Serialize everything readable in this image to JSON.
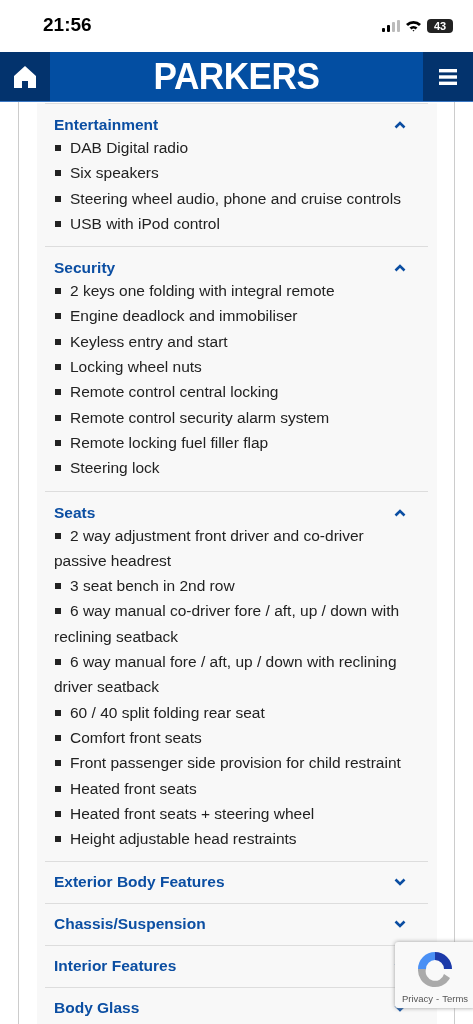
{
  "status_bar": {
    "time": "21:56",
    "battery": "43"
  },
  "header": {
    "logo": "PARKERS"
  },
  "sections": [
    {
      "title": "Entertainment",
      "expanded": true,
      "items": [
        "DAB Digital radio",
        "Six speakers",
        "Steering wheel audio, phone and cruise controls",
        "USB with iPod control"
      ]
    },
    {
      "title": "Security",
      "expanded": true,
      "items": [
        "2 keys one folding with integral remote",
        "Engine deadlock and immobiliser",
        "Keyless entry and start",
        "Locking wheel nuts",
        "Remote control central locking",
        "Remote control security alarm system",
        "Remote locking fuel filler flap",
        "Steering lock"
      ]
    },
    {
      "title": "Seats",
      "expanded": true,
      "items": [
        "2 way adjustment front driver and co-driver passive headrest",
        "3 seat bench in 2nd row",
        "6 way manual co-driver fore / aft, up / down with reclining seatback",
        "6 way manual fore / aft, up / down with reclining driver seatback",
        "60 / 40 split folding rear seat",
        "Comfort front seats",
        "Front passenger side provision for child restraint",
        "Heated front seats",
        "Heated front seats + steering wheel",
        "Height adjustable head restraints"
      ]
    },
    {
      "title": "Exterior Body Features",
      "expanded": false
    },
    {
      "title": "Chassis/Suspension",
      "expanded": false
    },
    {
      "title": "Interior Features",
      "expanded": false
    },
    {
      "title": "Body Glass",
      "expanded": false
    }
  ],
  "recaptcha": {
    "privacy": "Privacy",
    "separator": "-",
    "terms": "Terms"
  }
}
